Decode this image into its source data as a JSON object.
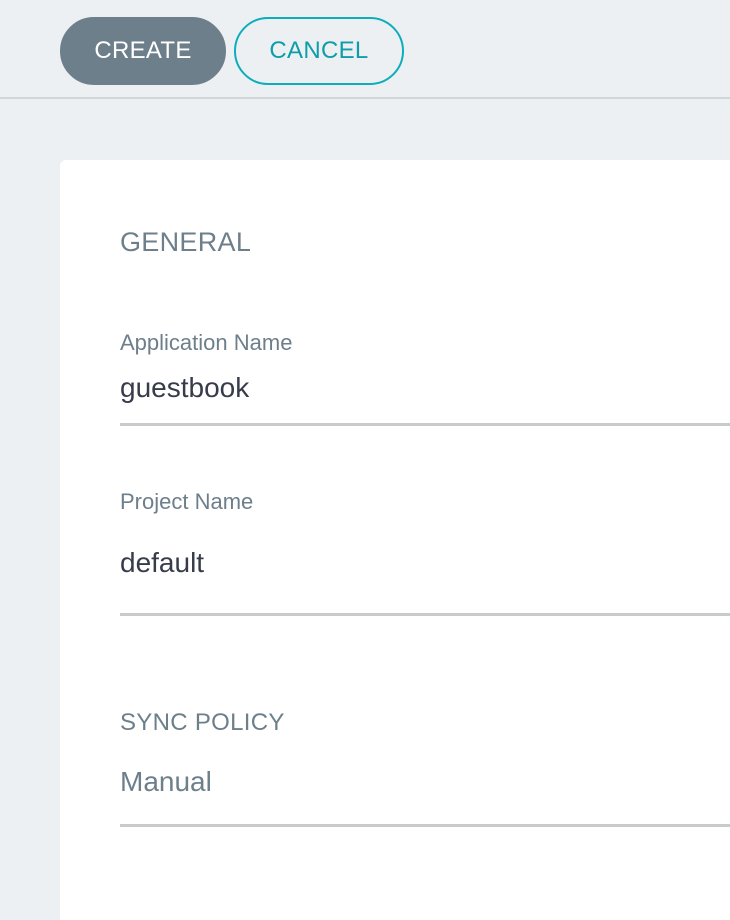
{
  "toolbar": {
    "create_label": "CREATE",
    "cancel_label": "CANCEL"
  },
  "form": {
    "general": {
      "title": "GENERAL",
      "application_name": {
        "label": "Application Name",
        "value": "guestbook"
      },
      "project_name": {
        "label": "Project Name",
        "value": "default"
      }
    },
    "sync_policy": {
      "title": "SYNC POLICY",
      "selected": "Manual"
    }
  },
  "colors": {
    "primary_button": "#6d7f8b",
    "accent": "#0dadb9",
    "background": "#edf0f3",
    "text_muted": "#6d7f8b",
    "text_dark": "#363c4a"
  }
}
